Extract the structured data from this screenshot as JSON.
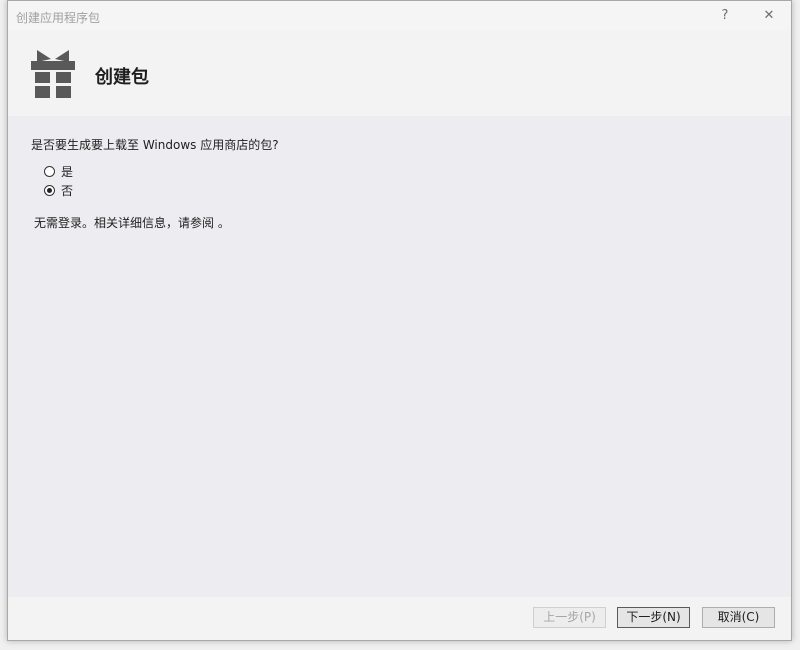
{
  "window": {
    "title": "创建应用程序包",
    "help_glyph": "?",
    "close_glyph": "✕"
  },
  "header": {
    "icon": "gift-package-icon",
    "title": "创建包"
  },
  "main": {
    "question": "是否要生成要上载至 Windows 应用商店的包?",
    "options": [
      {
        "label": "是",
        "checked": false
      },
      {
        "label": "否",
        "checked": true
      }
    ],
    "info_text": "无需登录。相关详细信息，请参阅 。"
  },
  "footer": {
    "back_label": "上一步(P)",
    "next_label": "下一步(N)",
    "cancel_label": "取消(C)"
  },
  "colors": {
    "body_bg": "#ededf1",
    "header_bg": "#f3f3f3",
    "icon_color": "#595959"
  }
}
